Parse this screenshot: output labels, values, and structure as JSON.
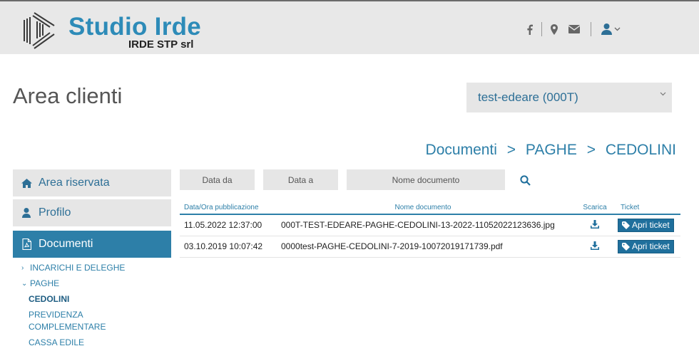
{
  "header": {
    "logo_title": "Studio Irde",
    "logo_subtitle": "IRDE STP srl",
    "icons": [
      "facebook-icon",
      "map-marker-icon",
      "envelope-icon",
      "user-icon",
      "chevron-down-icon"
    ]
  },
  "page": {
    "title": "Area clienti"
  },
  "client_select": {
    "value": "test-edeare (000T)"
  },
  "breadcrumb": {
    "items": [
      "Documenti",
      "PAGHE",
      "CEDOLINI"
    ],
    "separator": ">"
  },
  "sidebar": {
    "items": [
      {
        "label": "Area riservata",
        "icon": "home-icon"
      },
      {
        "label": "Profilo",
        "icon": "user-icon"
      },
      {
        "label": "Documenti",
        "icon": "file-pdf-icon",
        "active": true
      }
    ],
    "submenu": [
      {
        "label": "INCARICHI E DELEGHE",
        "arrow": "›"
      },
      {
        "label": "PAGHE",
        "arrow": "⌄"
      }
    ],
    "subsubmenu": [
      {
        "label": "CEDOLINI",
        "current": true
      },
      {
        "label": "PREVIDENZA COMPLEMENTARE"
      },
      {
        "label": "CASSA EDILE"
      }
    ]
  },
  "filters": {
    "date_from": "Data da",
    "date_to": "Data a",
    "doc_name": "Nome documento"
  },
  "table": {
    "columns": [
      "Data/Ora pubblicazione",
      "Nome documento",
      "Scarica",
      "Ticket"
    ],
    "rows": [
      {
        "date": "11.05.2022 12:37:00",
        "name": "000T-TEST-EDEARE-PAGHE-CEDOLINI-13-2022-11052022123636.jpg",
        "ticket": "Apri ticket"
      },
      {
        "date": "03.10.2019 10:07:42",
        "name": "0000test-PAGHE-CEDOLINI-7-2019-10072019171739.pdf",
        "ticket": "Apri ticket"
      }
    ]
  },
  "colors": {
    "brand": "#2d8bb8",
    "accent": "#2d7fa8",
    "button": "#1f6f9c",
    "header_bg": "#e8e8e8",
    "panel_bg": "#e6e6e6"
  }
}
